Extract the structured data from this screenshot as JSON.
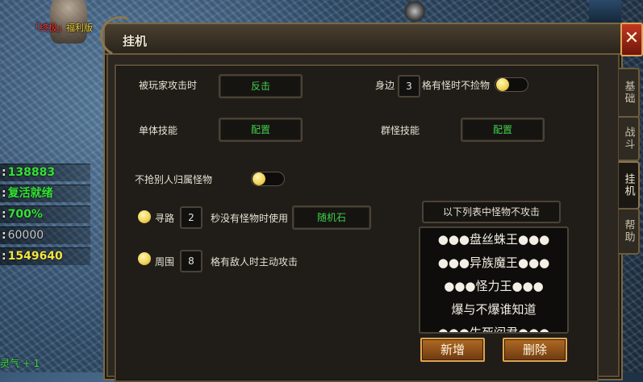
{
  "background": {
    "player_tag_prefix": "「终极」",
    "player_tag_name": "福利版",
    "stats": [
      {
        "value": "138883",
        "color": "green"
      },
      {
        "value": "复活就绪",
        "color": "green"
      },
      {
        "value": "700%",
        "color": "green"
      },
      {
        "value": "60000",
        "color": "grey"
      },
      {
        "value": "1549640",
        "color": "yellow"
      }
    ],
    "bottom_text": "灵气 + 1"
  },
  "window": {
    "title": "挂机",
    "close_glyph": "✕"
  },
  "side_tabs": [
    {
      "label": "基础",
      "active": false
    },
    {
      "label": "战斗",
      "active": false
    },
    {
      "label": "挂机",
      "active": true
    },
    {
      "label": "帮助",
      "active": false
    }
  ],
  "settings": {
    "attacked_by_player_label": "被玩家攻击时",
    "attacked_by_player_action": "反击",
    "nearby_prefix": "身边",
    "nearby_count": "3",
    "nearby_suffix": "格有怪时不捡物",
    "nearby_toggle_on": true,
    "single_skill_label": "单体技能",
    "single_skill_button": "配置",
    "group_skill_label": "群怪技能",
    "group_skill_button": "配置",
    "no_steal_label": "不抢别人归属怪物",
    "no_steal_toggle_on": true,
    "pathfind_label": "寻路",
    "pathfind_seconds": "2",
    "pathfind_suffix": "秒没有怪物时使用",
    "pathfind_item": "随机石",
    "around_label": "周围",
    "around_count": "8",
    "around_suffix": "格有敌人时主动攻击"
  },
  "monster_list": {
    "header": "以下列表中怪物不攻击",
    "items": [
      "●●●盘丝蛛王●●●",
      "●●●异族魔王●●●",
      "●●●怪力王●●●",
      "爆与不爆谁知道",
      "●●●生死阎君●●●"
    ],
    "add_button": "新增",
    "delete_button": "删除"
  }
}
